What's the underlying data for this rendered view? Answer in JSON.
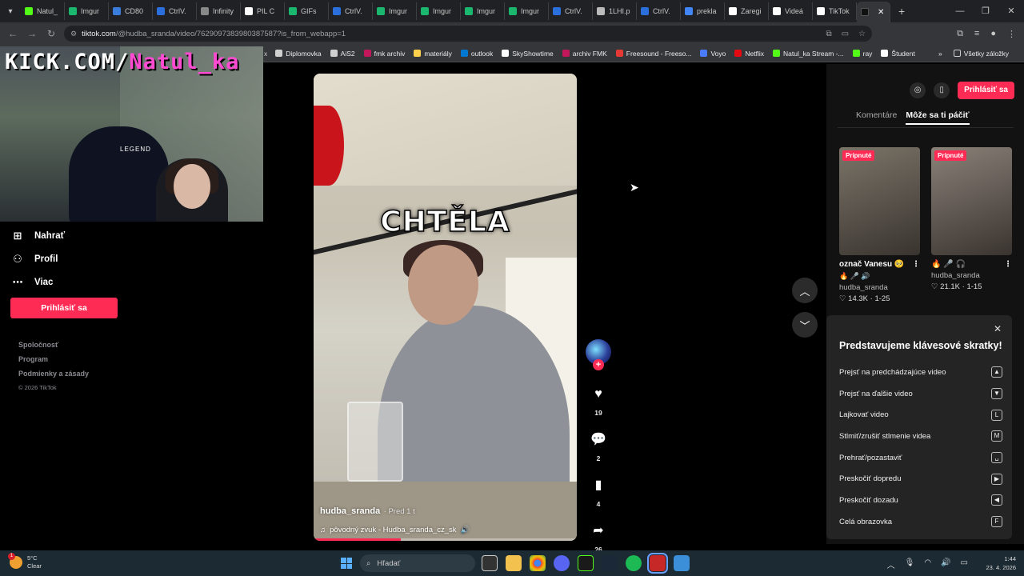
{
  "browser": {
    "tabs": [
      {
        "label": "Natul_",
        "color": "#53fc18"
      },
      {
        "label": "Imgur",
        "color": "#1bb76e"
      },
      {
        "label": "CD80",
        "color": "#3b7ddd"
      },
      {
        "label": "CtrlV.",
        "color": "#2a6fdb"
      },
      {
        "label": "Infinity",
        "color": "#888888"
      },
      {
        "label": "PIL C",
        "color": "#ffffff"
      },
      {
        "label": "GIFs",
        "color": "#1bb76e"
      },
      {
        "label": "CtrlV.",
        "color": "#2a6fdb"
      },
      {
        "label": "Imgur",
        "color": "#1bb76e"
      },
      {
        "label": "Imgur",
        "color": "#1bb76e"
      },
      {
        "label": "Imgur",
        "color": "#1bb76e"
      },
      {
        "label": "Imgur",
        "color": "#1bb76e"
      },
      {
        "label": "CtrlV.",
        "color": "#2a6fdb"
      },
      {
        "label": "1LHI.p",
        "color": "#bbbbbb"
      },
      {
        "label": "CtrlV.",
        "color": "#2a6fdb"
      },
      {
        "label": "prekla",
        "color": "#4285f4"
      },
      {
        "label": "Zaregi",
        "color": "#ffffff"
      },
      {
        "label": "Videá",
        "color": "#ffffff"
      },
      {
        "label": "TikTok",
        "color": "#ffffff"
      }
    ],
    "active_tab_icon": "tiktok-icon",
    "url_domain": "tiktok.com",
    "url_path": "/@hudba_sranda/video/7629097383980387587?is_from_webapp=1",
    "bookmarks": [
      {
        "label": "Diplomovka",
        "color": "#d0d0d0"
      },
      {
        "label": "AiS2",
        "color": "#d0d0d0"
      },
      {
        "label": "fmk archiv",
        "color": "#c2185b"
      },
      {
        "label": "materiály",
        "color": "#ffd04b"
      },
      {
        "label": "outlook",
        "color": "#0078d4"
      },
      {
        "label": "SkyShowtime",
        "color": "#ffffff"
      },
      {
        "label": "archiv FMK",
        "color": "#c2185b"
      },
      {
        "label": "Freesound - Freeso...",
        "color": "#e53935"
      },
      {
        "label": "Voyo",
        "color": "#4a7bff"
      },
      {
        "label": "Netflix",
        "color": "#e50914"
      },
      {
        "label": "Natul_ka Stream -...",
        "color": "#53fc18"
      },
      {
        "label": "ray",
        "color": "#53fc18"
      },
      {
        "label": "Študent",
        "color": "#ffffff"
      }
    ],
    "all_bookmarks": "Všetky záložky"
  },
  "overlay": {
    "kick_prefix": "KICK.COM/",
    "kick_user": "Natul_ka",
    "cam_logo": "LEGEND"
  },
  "sidebar": {
    "items": [
      {
        "label": "Nahrať",
        "icon": "upload-icon"
      },
      {
        "label": "Profil",
        "icon": "profile-icon"
      },
      {
        "label": "Viac",
        "icon": "more-icon"
      }
    ],
    "login": "Prihlásiť sa",
    "links": [
      "Spoločnosť",
      "Program",
      "Podmienky a zásady"
    ],
    "copyright": "© 2026 TikTok"
  },
  "video": {
    "caption": "CHTĚLA",
    "author": "hudba_sranda",
    "time": "· Pred 1 t",
    "sound": "pôvodný zvuk - Hudba_sranda_cz_sk",
    "progress": 0.33,
    "likes": "19",
    "comments": "2",
    "saves": "4",
    "shares": "26"
  },
  "right_panel": {
    "login": "Prihlásiť sa",
    "tabs": [
      "Komentáre",
      "Môže sa ti páčiť"
    ],
    "active_tab": 1,
    "cards": [
      {
        "pinned": "Pripnuté",
        "title": "označ Vanesu 🥺",
        "emoji": "🔥 🎤 🔊",
        "author": "hudba_sranda",
        "likes": "14.3K",
        "date": "1-25",
        "thumb_color": "#7a7468"
      },
      {
        "pinned": "Pripnuté",
        "title": "",
        "emoji": "🔥 🎤 🎧",
        "author": "hudba_sranda",
        "likes": "21.1K",
        "date": "1-15",
        "thumb_color": "#8a8178"
      }
    ]
  },
  "shortcuts": {
    "title": "Predstavujeme klávesové skratky!",
    "rows": [
      {
        "label": "Prejsť na predchádzajúce video",
        "key": "▲"
      },
      {
        "label": "Prejsť na ďalšie video",
        "key": "▼"
      },
      {
        "label": "Lajkovať video",
        "key": "L"
      },
      {
        "label": "Stlmiť/zrušiť stlmenie videa",
        "key": "M"
      },
      {
        "label": "Prehrať/pozastaviť",
        "key": "␣"
      },
      {
        "label": "Preskočiť dopredu",
        "key": "▶"
      },
      {
        "label": "Preskočiť dozadu",
        "key": "◀"
      },
      {
        "label": "Celá obrazovka",
        "key": "F"
      }
    ]
  },
  "taskbar": {
    "temp": "5°C",
    "weather": "Clear",
    "weather_badge": "1",
    "search_placeholder": "Hľadať",
    "time": "1:44",
    "date": "23. 4. 2026"
  }
}
